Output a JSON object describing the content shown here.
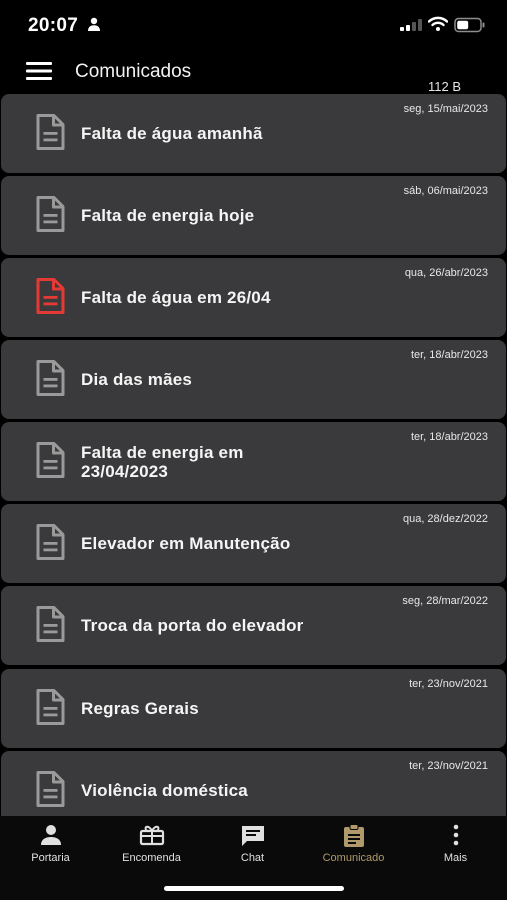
{
  "status_bar": {
    "time": "20:07"
  },
  "header": {
    "title": "Comunicados",
    "unit": "112 B"
  },
  "notices": [
    {
      "title": "Falta de água amanhã",
      "date": "seg, 15/mai/2023",
      "unread": false
    },
    {
      "title": "Falta de energia hoje",
      "date": "sáb, 06/mai/2023",
      "unread": false
    },
    {
      "title": "Falta de água em 26/04",
      "date": "qua, 26/abr/2023",
      "unread": true
    },
    {
      "title": "Dia das mães",
      "date": "ter, 18/abr/2023",
      "unread": false
    },
    {
      "title": "Falta de energia em 23/04/2023",
      "date": "ter, 18/abr/2023",
      "unread": false
    },
    {
      "title": "Elevador em Manutenção",
      "date": "qua, 28/dez/2022",
      "unread": false
    },
    {
      "title": "Troca da porta do elevador",
      "date": "seg, 28/mar/2022",
      "unread": false
    },
    {
      "title": "Regras Gerais",
      "date": "ter, 23/nov/2021",
      "unread": false
    },
    {
      "title": "Violência doméstica",
      "date": "ter, 23/nov/2021",
      "unread": false
    }
  ],
  "tabs": [
    {
      "label": "Portaria",
      "icon": "person-icon",
      "active": false
    },
    {
      "label": "Encomenda",
      "icon": "package-icon",
      "active": false
    },
    {
      "label": "Chat",
      "icon": "chat-icon",
      "active": false
    },
    {
      "label": "Comunicado",
      "icon": "clipboard-icon",
      "active": true
    },
    {
      "label": "Mais",
      "icon": "more-vertical-icon",
      "active": false
    }
  ],
  "colors": {
    "background": "#000000",
    "card": "#3a3a3c",
    "icon_default": "#9a9a9a",
    "icon_unread": "#e53935",
    "tab_active": "#b09a6c"
  }
}
